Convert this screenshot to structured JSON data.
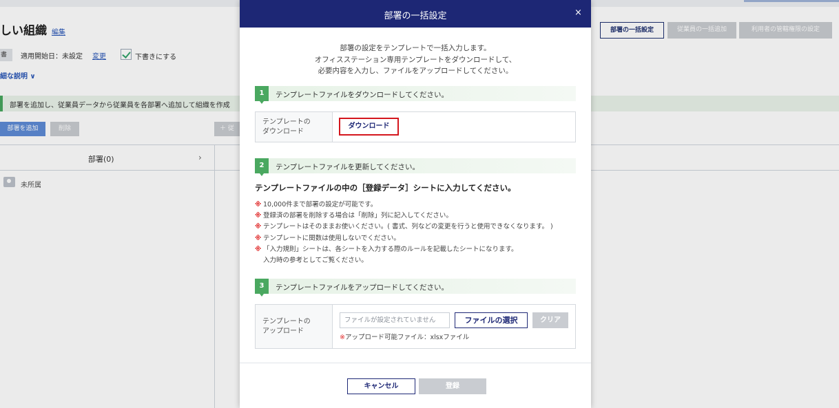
{
  "background": {
    "page_title": "しい組織",
    "edit_link": "編集",
    "tag": "書き",
    "start_date": "適用開始日：未設定",
    "change_link": "変更",
    "draft_label": "下書きにする",
    "explain_link": "細な説明 ∨",
    "notice": "部署を追加し、従業員データから従業員を各部署へ追加して組織を作成",
    "add_dept_button": "部署を追加",
    "delete_button": "削除",
    "add_emp_button": "＋ 従",
    "dept_column": "部署(0)",
    "unassigned": "未所属",
    "right_buttons": {
      "bulk_dept": "部署の一括設定",
      "bulk_emp": "従業員の一括追加",
      "admin_perm": "利用者の管轄権限の設定"
    }
  },
  "modal": {
    "title": "部署の一括設定",
    "close": "×",
    "intro": [
      "部署の設定をテンプレートで一括入力します。",
      "オフィスステーション専用テンプレートをダウンロードして、",
      "必要内容を入力し、ファイルをアップロードしてください。"
    ],
    "step1": {
      "number": "1",
      "label": "テンプレートファイルをダウンロードしてください。",
      "row_label_1": "テンプレートの",
      "row_label_2": "ダウンロード",
      "button": "ダウンロード"
    },
    "step2": {
      "number": "2",
      "label": "テンプレートファイルを更新してください。",
      "heading": "テンプレートファイルの中の［登録データ］シートに入力してください。",
      "mark": "※",
      "notes": [
        "10,000件まで部署の設定が可能です。",
        "登録済の部署を削除する場合は「削除」列に記入してください。",
        "テンプレートはそのままお使いください。( 書式、列などの変更を行うと使用できなくなります。 )",
        "テンプレートに関数は使用しないでください。",
        "「入力規則」シートは、各シートを入力する際のルールを記載したシートになります。"
      ],
      "note_continuation": "入力時の参考としてご覧ください。"
    },
    "step3": {
      "number": "3",
      "label": "テンプレートファイルをアップロードしてください。",
      "row_label_1": "テンプレートの",
      "row_label_2": "アップロード",
      "file_placeholder": "ファイルが設定されていません",
      "select_button": "ファイルの選択",
      "clear_button": "クリア",
      "hint_mark": "※",
      "hint": "アップロード可能ファイル：xlsxファイル"
    },
    "footer": {
      "cancel": "キャンセル",
      "register": "登録"
    }
  }
}
